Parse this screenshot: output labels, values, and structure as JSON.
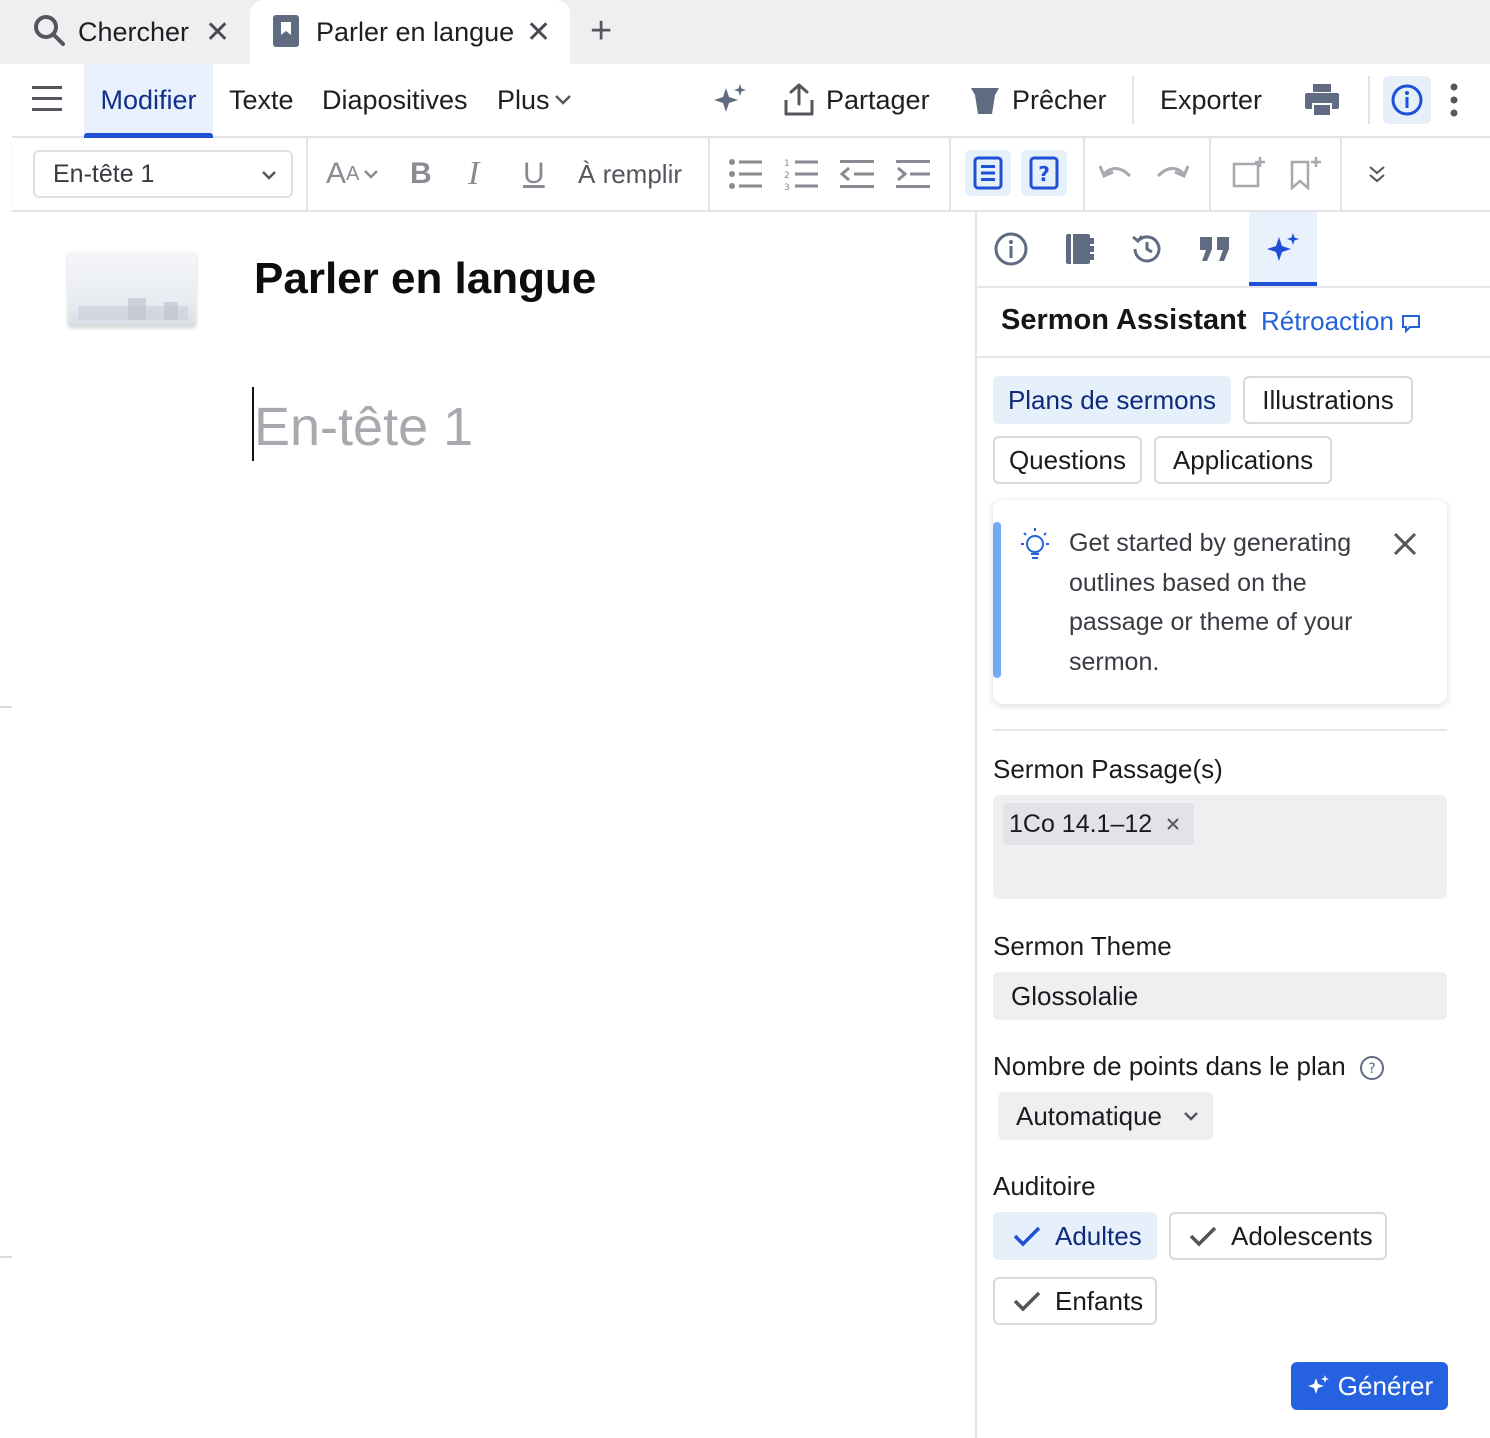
{
  "tabs": {
    "search_label": "Chercher",
    "doc_label": "Parler en langue",
    "close_glyph": "✕",
    "new_glyph": "+"
  },
  "menu": {
    "modifier": "Modifier",
    "texte": "Texte",
    "diapositives": "Diapositives",
    "plus": "Plus",
    "partager": "Partager",
    "precher": "Prêcher",
    "exporter": "Exporter"
  },
  "format": {
    "style_value": "En-tête 1",
    "fill_label": "À remplir"
  },
  "document": {
    "title": "Parler en langue",
    "heading_placeholder": "En-tête 1"
  },
  "panel": {
    "title": "Sermon Assistant",
    "feedback": "Rétroaction",
    "chips": [
      "Plans de sermons",
      "Illustrations",
      "Questions",
      "Applications"
    ],
    "tip": "Get started by generating outlines based on the passage or theme of your sermon.",
    "passage_label": "Sermon Passage(s)",
    "passage_value": "1Co 14.1–12",
    "theme_label": "Sermon Theme",
    "theme_value": "Glossolalie",
    "points_label": "Nombre de points dans le plan",
    "points_value": "Automatique",
    "audience_label": "Auditoire",
    "audience": [
      "Adultes",
      "Adolescents",
      "Enfants"
    ],
    "generate": "Générer"
  },
  "colors": {
    "accent": "#2662e0",
    "link": "#2463d8",
    "selected_bg": "#e6f0fb"
  }
}
